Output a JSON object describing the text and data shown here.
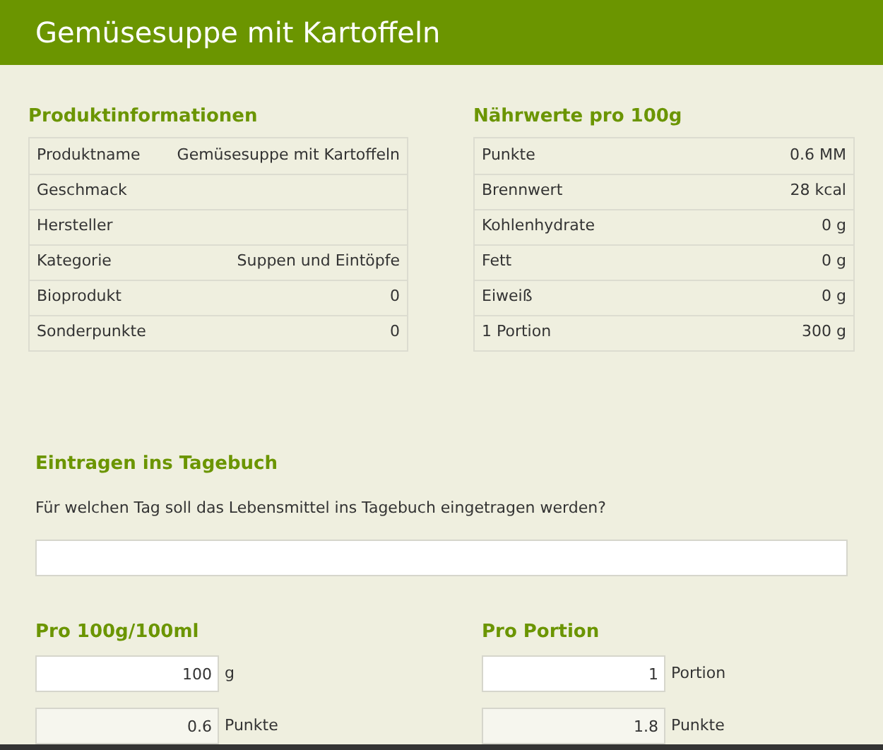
{
  "title": "Gemüsesuppe mit Kartoffeln",
  "product_info": {
    "heading": "Produktinformationen",
    "rows": [
      {
        "label": "Produktname",
        "value": "Gemüsesuppe mit Kartoffeln"
      },
      {
        "label": "Geschmack"
      },
      {
        "label": "Hersteller"
      },
      {
        "label": "Kategorie",
        "value": "Suppen und Eintöpfe"
      },
      {
        "label": "Bioprodukt",
        "value": "0"
      },
      {
        "label": "Sonderpunkte",
        "value": "0"
      }
    ]
  },
  "nutrition": {
    "heading": "Nährwerte pro 100g",
    "rows": [
      {
        "label": "Punkte",
        "value": "0.6 MM"
      },
      {
        "label": "Brennwert",
        "value": "28 kcal"
      },
      {
        "label": "Kohlenhydrate",
        "value": "0 g"
      },
      {
        "label": "Fett",
        "value": "0 g"
      },
      {
        "label": "Eiweiß",
        "value": "0 g"
      },
      {
        "label": "1 Portion",
        "value": "300 g"
      }
    ]
  },
  "diary": {
    "heading": "Eintragen ins Tagebuch",
    "question": "Für welchen Tag soll das Lebensmittel ins Tagebuch eingetragen werden?"
  },
  "calculators": [
    {
      "heading": "Pro 100g/100ml",
      "fields": [
        {
          "value": "100",
          "unit": "g",
          "readonly": false
        },
        {
          "value": "0.6",
          "unit": "Punkte",
          "readonly": true
        }
      ]
    },
    {
      "heading": "Pro Portion",
      "fields": [
        {
          "value": "1",
          "unit": "Portion",
          "readonly": false
        },
        {
          "value": "1.8",
          "unit": "Punkte",
          "readonly": true
        }
      ]
    }
  ]
}
